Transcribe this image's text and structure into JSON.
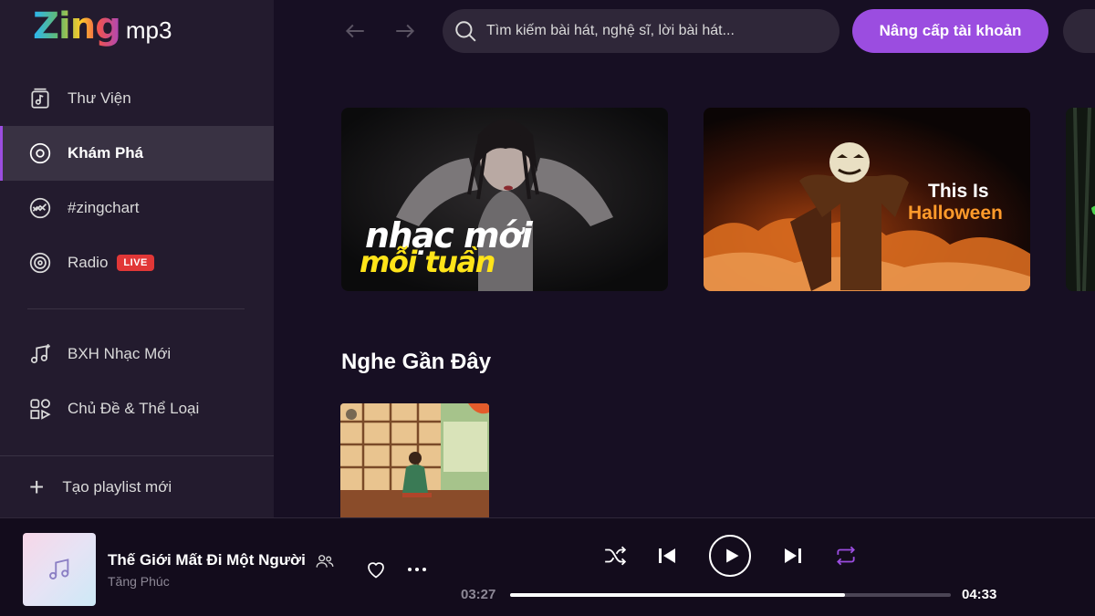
{
  "logo": {
    "main": "Zing",
    "sub": "mp3"
  },
  "nav": {
    "items": [
      {
        "label": "Thư Viện",
        "icon": "library-icon"
      },
      {
        "label": "Khám Phá",
        "icon": "discover-icon",
        "active": true
      },
      {
        "label": "#zingchart",
        "icon": "chart-icon"
      },
      {
        "label": "Radio",
        "icon": "radio-icon",
        "badge": "LIVE"
      }
    ],
    "secondary": [
      {
        "label": "BXH Nhạc Mới",
        "icon": "music-notes-icon"
      },
      {
        "label": "Chủ Đề & Thể Loại",
        "icon": "categories-icon"
      }
    ],
    "new_playlist": "Tạo playlist mới"
  },
  "header": {
    "search_placeholder": "Tìm kiếm bài hát, nghệ sĩ, lời bài hát...",
    "upgrade_label": "Nâng cấp tài khoản"
  },
  "banners": [
    {
      "line1": "nhạc mới",
      "line2": "mỗi tuần"
    },
    {
      "line1": "This Is",
      "line2": "Halloween"
    }
  ],
  "section": {
    "title": "Nghe Gần Đây"
  },
  "player": {
    "song_title": "Thế Giới Mất Đi Một Người",
    "artist": "Tăng Phúc",
    "current_time": "03:27",
    "total_time": "04:33",
    "progress": 0.76
  },
  "colors": {
    "accent": "#9b4de0",
    "live": "#e13737",
    "highlight": "#ffe419",
    "halloween": "#ff9b2b"
  }
}
